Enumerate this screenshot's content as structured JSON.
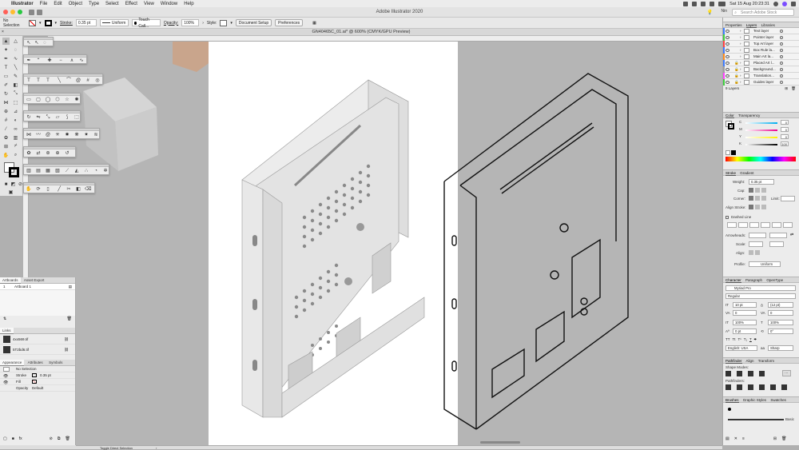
{
  "menubar": {
    "apple": "",
    "app": "Illustrator",
    "items": [
      "File",
      "Edit",
      "Object",
      "Type",
      "Select",
      "Effect",
      "View",
      "Window",
      "Help"
    ],
    "clock": "Sat 15 Aug  20:23:31"
  },
  "titlebar": {
    "title": "Adobe Illustrator 2020",
    "user": "Nin",
    "search_placeholder": "Search Adobe Stock"
  },
  "controlbar": {
    "selection": "No Selection",
    "stroke_label": "Stroke:",
    "stroke_value": "0.35 pt",
    "profile_value": "Uniform",
    "brush_value": "Touch Call...",
    "opacity_label": "Opacity:",
    "opacity_value": "100%",
    "style_label": "Style:",
    "doc_setup_label": "Document Setup",
    "preferences_label": "Preferences"
  },
  "document": {
    "tab_title": "GN40465C_01.ai* @ 600% (CMYK/GPU Preview)"
  },
  "left_panels": {
    "artboards": {
      "tabs": [
        "Artboards",
        "Asset Export"
      ],
      "rows": [
        {
          "num": "1",
          "name": "Artboard 1"
        }
      ]
    },
    "links": {
      "tab": "Links",
      "rows": [
        {
          "name": "4xx569.tif"
        },
        {
          "name": "5T2bd6.tif"
        }
      ]
    },
    "appearance": {
      "tabs": [
        "Appearance",
        "Attributes",
        "Symbols"
      ],
      "selection": "No Selection",
      "stroke_label": "Stroke",
      "stroke_value": "0.35 pt",
      "fill_label": "Fill",
      "opacity_label": "Opacity",
      "opacity_value": "Default"
    }
  },
  "status": {
    "tool_hint": "Toggle Direct Selection"
  },
  "right_panel": {
    "layers": {
      "tabs": [
        "Properties",
        "Layers",
        "Libraries"
      ],
      "items": [
        {
          "name": "Text layer",
          "color": "#3d7cff"
        },
        {
          "name": "Pointer layer",
          "color": "#3ecf3e"
        },
        {
          "name": "Top Art layer",
          "color": "#ff4040"
        },
        {
          "name": "Box Rule la...",
          "color": "#3d7cff"
        },
        {
          "name": "Main Art la...",
          "color": "#ff8c1a"
        },
        {
          "name": "Placed Art l...",
          "color": "#3d7cff"
        },
        {
          "name": "Background...",
          "color": "#9e9e9e"
        },
        {
          "name": "Translation...",
          "color": "#ff40ff"
        },
        {
          "name": "Guides layer",
          "color": "#3ecf3e"
        }
      ],
      "count": "9 Layers"
    },
    "color": {
      "tabs": [
        "Color",
        "Transparency"
      ],
      "channels": [
        {
          "label": "C",
          "value": "0"
        },
        {
          "label": "M",
          "value": "0"
        },
        {
          "label": "Y",
          "value": "0"
        },
        {
          "label": "K",
          "value": "100"
        }
      ]
    },
    "stroke": {
      "tabs": [
        "Stroke",
        "Gradient"
      ],
      "weight_label": "Weight:",
      "weight_value": "0.35 pt",
      "cap_label": "Cap:",
      "corner_label": "Corner:",
      "limit_label": "Limit:",
      "align_label": "Align Stroke:",
      "dashed_label": "Dashed Line",
      "arrowheads_label": "Arrowheads:",
      "scale_label": "Scale:",
      "align2_label": "Align:",
      "profile_label": "Profile:",
      "profile_value": "Uniform"
    },
    "character": {
      "tabs": [
        "Character",
        "Paragraph",
        "OpenType"
      ],
      "font_family": "Myriad Pro",
      "font_style": "Regular",
      "size": "10 pt",
      "leading": "(12 pt)",
      "kerning": "0",
      "tracking": "0",
      "vscale": "100%",
      "hscale": "100%",
      "baseline": "0 pt",
      "rotation": "0°",
      "language": "English: USA",
      "antialias": "Sharp"
    },
    "pathfinder": {
      "tabs": [
        "Pathfinder",
        "Align",
        "Transform"
      ],
      "shape_modes_label": "Shape Modes:",
      "pathfinders_label": "Pathfinders:"
    },
    "brushes": {
      "tabs": [
        "Brushes",
        "Graphic Styles",
        "Swatches"
      ],
      "basic_label": "Basic"
    }
  },
  "colors": {
    "canvas": "#b5b5b5",
    "artboard": "#ffffff",
    "panel": "#ececec",
    "object_fill": "#e2e2e2",
    "outline": "#111111"
  }
}
